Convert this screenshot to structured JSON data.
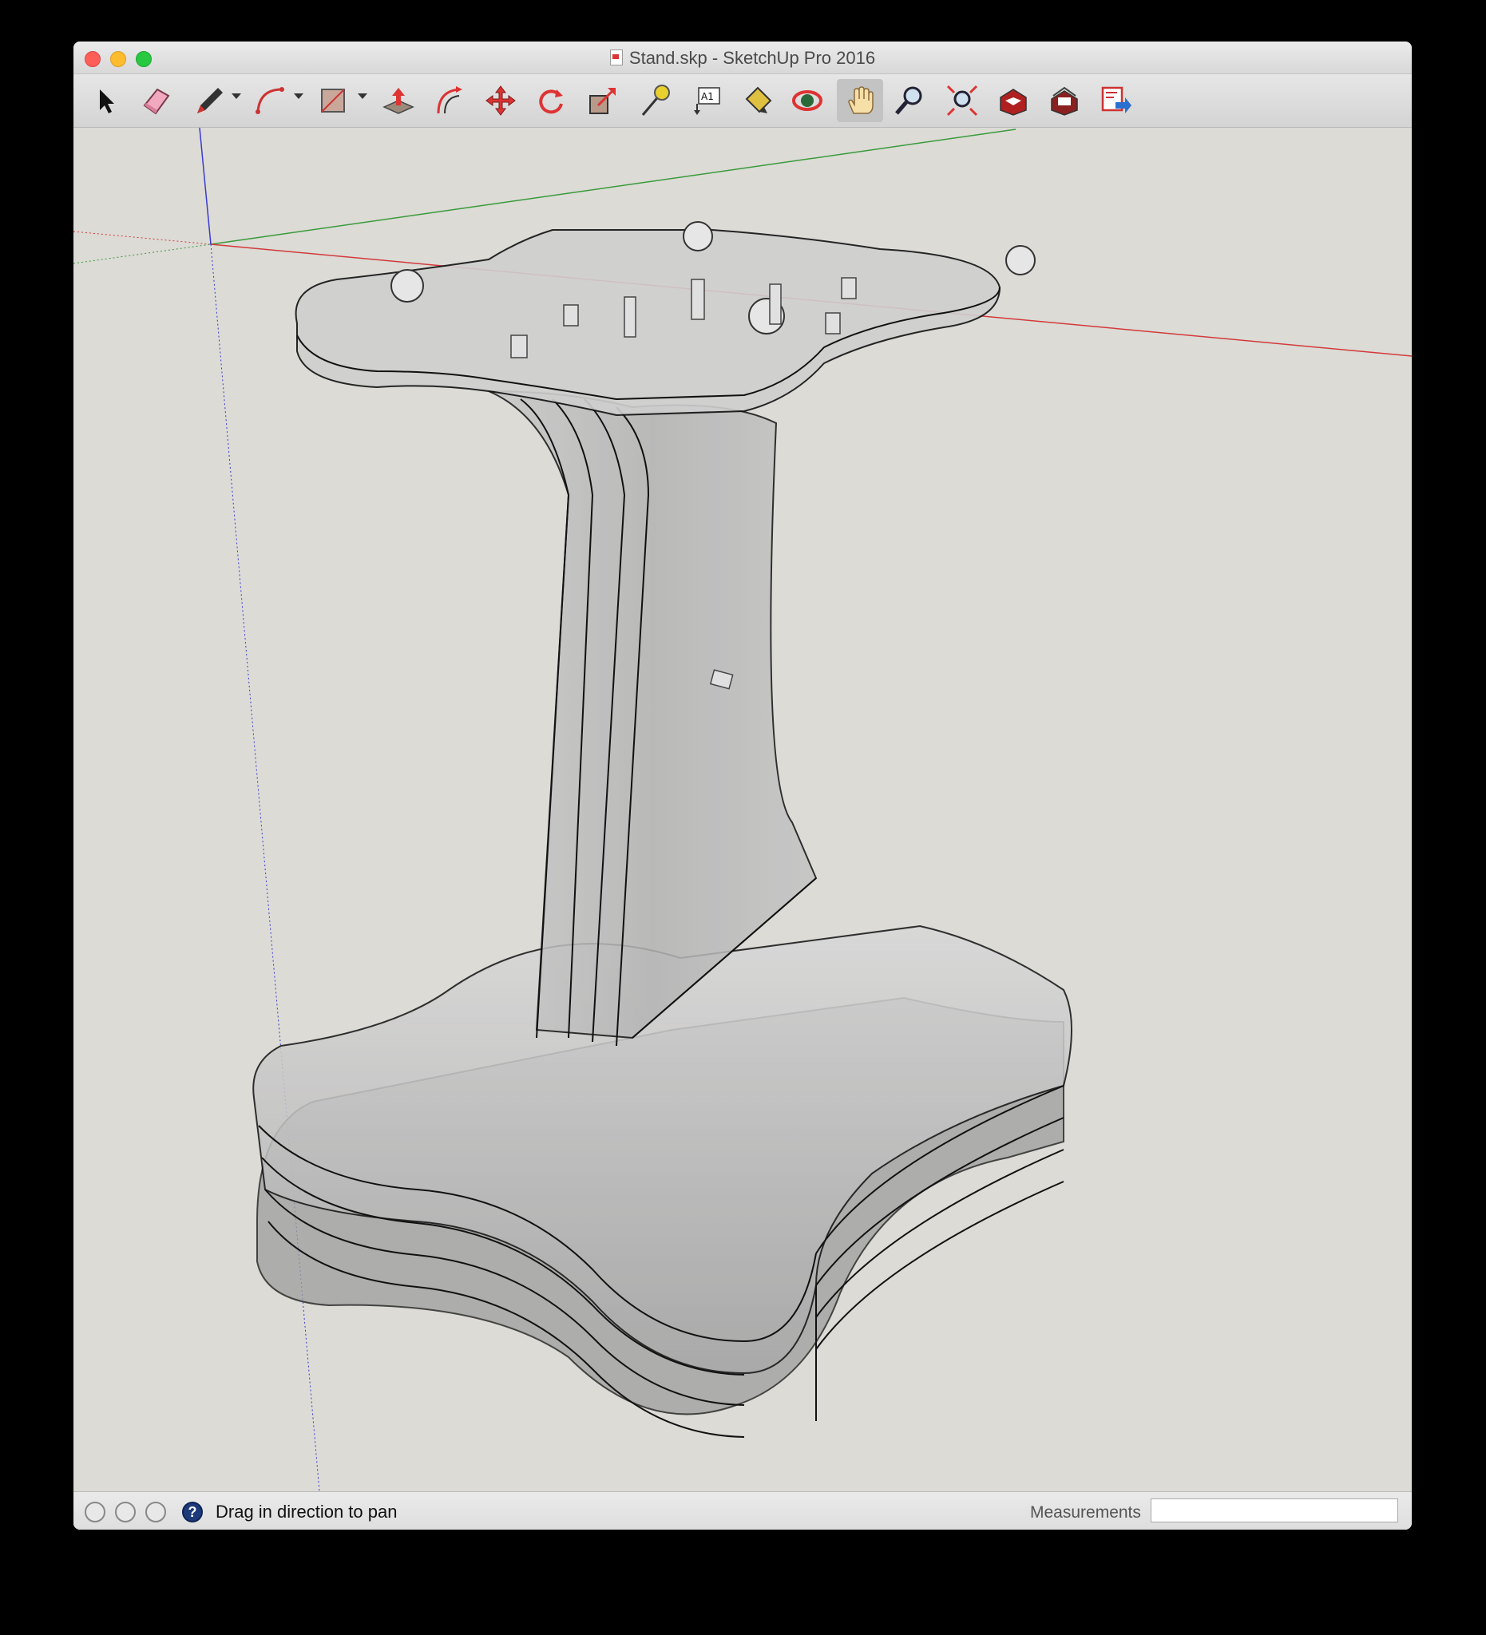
{
  "window": {
    "title": "Stand.skp - SketchUp Pro 2016"
  },
  "toolbar": {
    "tools": [
      {
        "name": "select-tool",
        "icon": "arrow-cursor-icon"
      },
      {
        "name": "eraser-tool",
        "icon": "eraser-icon"
      },
      {
        "name": "line-tool",
        "icon": "pencil-icon",
        "has_dropdown": true
      },
      {
        "name": "arc-tool",
        "icon": "arc-icon",
        "has_dropdown": true
      },
      {
        "name": "shapes-tool",
        "icon": "rectangle-icon",
        "has_dropdown": true
      },
      {
        "name": "push-pull-tool",
        "icon": "push-pull-icon"
      },
      {
        "name": "offset-tool",
        "icon": "offset-icon"
      },
      {
        "name": "move-tool",
        "icon": "move-icon"
      },
      {
        "name": "rotate-tool",
        "icon": "rotate-icon"
      },
      {
        "name": "scale-tool",
        "icon": "scale-icon"
      },
      {
        "name": "tape-measure-tool",
        "icon": "tape-measure-icon"
      },
      {
        "name": "text-tool",
        "icon": "text-label-icon",
        "label": "A1"
      },
      {
        "name": "paint-bucket-tool",
        "icon": "paint-bucket-icon"
      },
      {
        "name": "orbit-tool",
        "icon": "orbit-icon"
      },
      {
        "name": "pan-tool",
        "icon": "hand-icon",
        "active": true
      },
      {
        "name": "zoom-tool",
        "icon": "magnifier-icon"
      },
      {
        "name": "zoom-extents-tool",
        "icon": "zoom-extents-icon"
      },
      {
        "name": "3d-warehouse",
        "icon": "warehouse-icon"
      },
      {
        "name": "extension-warehouse",
        "icon": "extension-warehouse-icon"
      },
      {
        "name": "send-to-layout",
        "icon": "layout-icon"
      }
    ]
  },
  "status": {
    "hint": "Drag in direction to pan",
    "help_symbol": "?",
    "measurements_label": "Measurements",
    "measurements_value": ""
  },
  "colors": {
    "viewport_bg": "#dcdbd6",
    "axis_red": "#d33a3a",
    "axis_green": "#3a9a3a",
    "axis_blue": "#3a3ad3",
    "model_fill": "#b8b8b8"
  }
}
